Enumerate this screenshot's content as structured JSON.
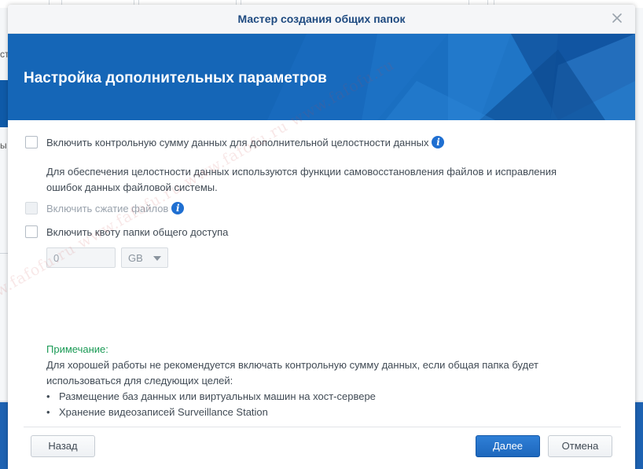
{
  "dialog": {
    "title": "Мастер создания общих папок",
    "heading": "Настройка дополнительных параметров"
  },
  "options": {
    "checksum_label": "Включить контрольную сумму данных для дополнительной целостности данных",
    "checksum_description": "Для обеспечения целостности данных используются функции самовосстановления файлов и исправления ошибок данных файловой системы.",
    "compression_label": "Включить сжатие файлов",
    "quota_label": "Включить квоту папки общего доступа",
    "quota_value": "0",
    "quota_unit": "GB"
  },
  "note": {
    "title": "Примечание:",
    "text": "Для хорошей работы не рекомендуется включать контрольную сумму данных, если общая папка будет использоваться для следующих целей:",
    "items": [
      "Размещение баз данных или виртуальных машин на хост-сервере",
      "Хранение видеозаписей Surveillance Station"
    ]
  },
  "buttons": {
    "back": "Назад",
    "next": "Далее",
    "cancel": "Отмена"
  },
  "background_app": {
    "left_text_1": "ст",
    "left_text_2": "ы"
  },
  "watermark": "www.fafofu.ru www.fafofu.ru www.fafofu.ru www.fafofu.ru",
  "colors": {
    "accent": "#1d67bd",
    "banner": "#1566b7",
    "note_title": "#1a9a55",
    "info_icon": "#1f6fd1"
  },
  "icons": {
    "close": "close-icon",
    "info": "info-icon"
  }
}
